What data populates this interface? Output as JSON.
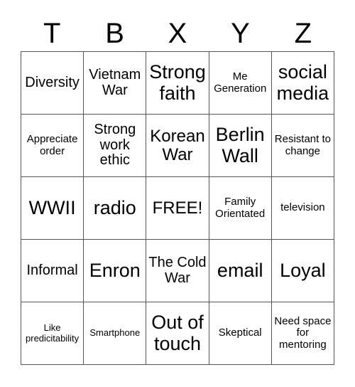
{
  "card": {
    "type": "bingo-card",
    "columns": 5,
    "rows": 5,
    "background_color": "#ffffff",
    "text_color": "#000000",
    "border_color": "#555555"
  },
  "header": {
    "letters": [
      "T",
      "B",
      "X",
      "Y",
      "Z"
    ]
  },
  "grid": {
    "cells": [
      {
        "text": "Diversity",
        "size": "md"
      },
      {
        "text": "Vietnam War",
        "size": "md"
      },
      {
        "text": "Strong faith",
        "size": "xl"
      },
      {
        "text": "Me Generation",
        "size": "sm"
      },
      {
        "text": "social media",
        "size": "xl"
      },
      {
        "text": "Appreciate order",
        "size": "sm"
      },
      {
        "text": "Strong work ethic",
        "size": "md"
      },
      {
        "text": "Korean War",
        "size": "lg"
      },
      {
        "text": "Berlin Wall",
        "size": "xl"
      },
      {
        "text": "Resistant to change",
        "size": "sm"
      },
      {
        "text": "WWII",
        "size": "xl"
      },
      {
        "text": "radio",
        "size": "xl"
      },
      {
        "text": "FREE!",
        "size": "lg"
      },
      {
        "text": "Family Orientated",
        "size": "sm"
      },
      {
        "text": "television",
        "size": "sm"
      },
      {
        "text": "Informal",
        "size": "md"
      },
      {
        "text": "Enron",
        "size": "xl"
      },
      {
        "text": "The Cold War",
        "size": "md"
      },
      {
        "text": "email",
        "size": "xl"
      },
      {
        "text": "Loyal",
        "size": "xl"
      },
      {
        "text": "Like predicitability",
        "size": "xs"
      },
      {
        "text": "Smartphone",
        "size": "xs"
      },
      {
        "text": "Out of touch",
        "size": "xl"
      },
      {
        "text": "Skeptical",
        "size": "sm"
      },
      {
        "text": "Need space for mentoring",
        "size": "sm"
      }
    ]
  }
}
